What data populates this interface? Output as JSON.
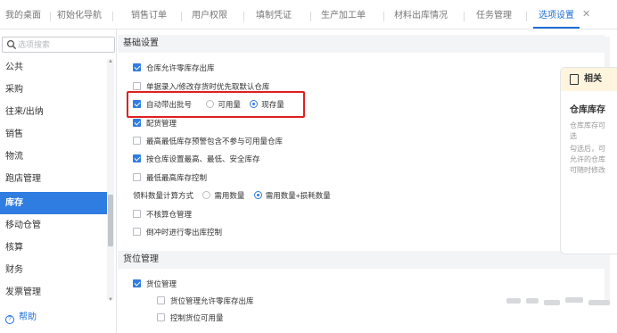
{
  "tabs": [
    {
      "label": "我的桌面",
      "active": false
    },
    {
      "label": "初始化导航",
      "active": false
    },
    {
      "label": "销售订单",
      "active": false
    },
    {
      "label": "用户权限",
      "active": false
    },
    {
      "label": "填制凭证",
      "active": false
    },
    {
      "label": "生产加工单",
      "active": false
    },
    {
      "label": "材料出库情况",
      "active": false
    },
    {
      "label": "任务管理",
      "active": false
    },
    {
      "label": "选项设置",
      "active": true
    }
  ],
  "tab_close_icon": "close-icon",
  "sidebar": {
    "search_placeholder": "选项搜索",
    "items": [
      {
        "label": "公共",
        "active": false
      },
      {
        "label": "采购",
        "active": false
      },
      {
        "label": "往来/出纳",
        "active": false
      },
      {
        "label": "销售",
        "active": false
      },
      {
        "label": "物流",
        "active": false
      },
      {
        "label": "跑店管理",
        "active": false
      },
      {
        "label": "库存",
        "active": true
      },
      {
        "label": "移动仓管",
        "active": false
      },
      {
        "label": "核算",
        "active": false
      },
      {
        "label": "财务",
        "active": false
      },
      {
        "label": "发票管理",
        "active": false
      }
    ],
    "help_label": "帮助"
  },
  "sections": {
    "basic": {
      "title": "基础设置",
      "rows": [
        {
          "type": "checkbox",
          "label": "仓库允许零库存出库",
          "checked": true
        },
        {
          "type": "checkbox",
          "label": "单据录入/修改存货时优先取默认仓库",
          "checked": false
        },
        {
          "type": "checkbox_radio",
          "label": "自动带出批号",
          "checked": true,
          "options": [
            {
              "label": "可用量",
              "selected": false
            },
            {
              "label": "现存量",
              "selected": true
            }
          ]
        },
        {
          "type": "checkbox",
          "label": "配货管理",
          "checked": true
        },
        {
          "type": "checkbox",
          "label": "最高最低库存预警包含不参与可用量仓库",
          "checked": false
        },
        {
          "type": "checkbox",
          "label": "按仓库设置最高、最低、安全库存",
          "checked": true
        },
        {
          "type": "checkbox",
          "label": "最低最高库存控制",
          "checked": false
        },
        {
          "type": "radio_group",
          "label": "领料数量计算方式",
          "options": [
            {
              "label": "需用数量",
              "selected": false
            },
            {
              "label": "需用数量+损耗数量",
              "selected": true
            }
          ]
        },
        {
          "type": "checkbox",
          "label": "不核算仓管理",
          "checked": false
        },
        {
          "type": "checkbox",
          "label": "倒冲时进行零出库控制",
          "checked": false
        }
      ]
    },
    "location": {
      "title": "货位管理",
      "rows": [
        {
          "type": "checkbox",
          "label": "货位管理",
          "checked": true
        },
        {
          "type": "checkbox",
          "label": "货位管理允许零库存出库",
          "checked": false,
          "indent": true
        },
        {
          "type": "checkbox",
          "label": "控制货位可用量",
          "checked": false,
          "indent": true
        }
      ]
    }
  },
  "related_panel": {
    "header": "相关",
    "header_icon": "document-icon",
    "title": "仓库库存",
    "lines": [
      "仓库库存可",
      "选",
      "勾选后，可",
      "允许的仓库",
      "可随时修改"
    ]
  },
  "colors": {
    "accent": "#2f7de1",
    "highlight": "#e02020",
    "panel_header": "#fff5df"
  }
}
